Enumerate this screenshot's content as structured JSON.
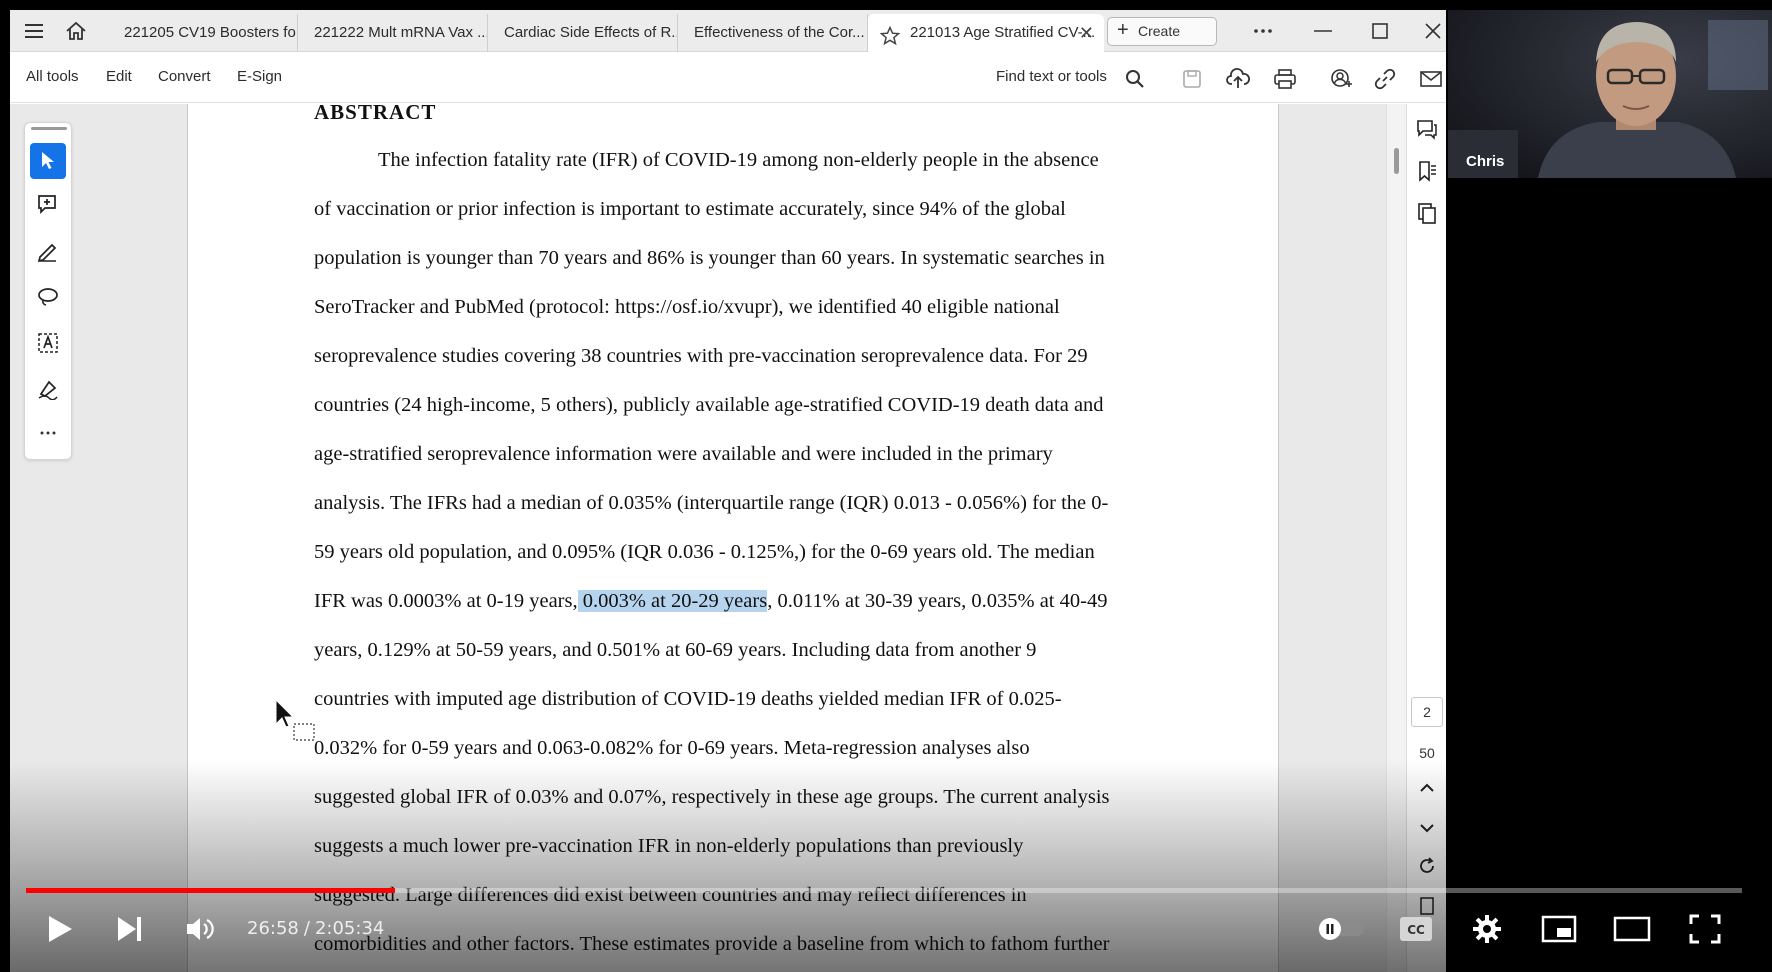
{
  "tabs": [
    {
      "label": "221205 CV19 Boosters fo..."
    },
    {
      "label": "221222 Mult mRNA Vax ..."
    },
    {
      "label": "Cardiac Side Effects of R..."
    },
    {
      "label": "Effectiveness of the Cor..."
    },
    {
      "label": "221013 Age Stratified CV-..."
    }
  ],
  "create_label": "Create",
  "menu": {
    "all_tools": "All tools",
    "edit": "Edit",
    "convert": "Convert",
    "esign": "E-Sign",
    "find": "Find text or tools"
  },
  "document": {
    "heading": "ABSTRACT",
    "lines": [
      "The infection fatality rate (IFR) of COVID-19 among non-elderly people in the absence",
      "of vaccination or prior infection is important to estimate accurately, since 94% of the global",
      "population is younger than 70 years and 86% is younger than 60 years. In systematic searches in",
      "SeroTracker and PubMed (protocol: https://osf.io/xvupr), we identified 40 eligible national",
      "seroprevalence studies covering 38 countries with pre-vaccination seroprevalence data. For 29",
      "countries (24 high-income, 5 others), publicly available age-stratified COVID-19 death data and",
      "age-stratified seroprevalence information were available and were included in the primary",
      "analysis. The IFRs had a median of 0.035% (interquartile range (IQR) 0.013 - 0.056%) for the 0-",
      "59 years old population, and 0.095% (IQR 0.036 - 0.125%,) for the 0-69 years old. The median"
    ],
    "line10": {
      "before": "IFR was 0.0003% at 0-19 years,",
      "highlight": " 0.003% at 20-29 years",
      "after": ", 0.011% at 30-39 years, 0.035% at 40-49"
    },
    "lines_after": [
      "years, 0.129% at 50-59 years, and 0.501% at 60-69 years. Including data from another 9",
      "countries with imputed age distribution of COVID-19 deaths yielded median IFR of 0.025-",
      "0.032% for 0-59 years and 0.063-0.082% for 0-69 years. Meta-regression analyses also",
      "suggested global IFR of 0.03% and 0.07%, respectively in these age groups. The current analysis",
      "suggests a much lower pre-vaccination IFR in non-elderly populations than previously",
      "suggested. Large differences did exist between countries and may reflect differences in",
      "comorbidities and other factors. These estimates provide a baseline from which to fathom further"
    ]
  },
  "page_nav": {
    "current": "2",
    "total": "50"
  },
  "webcam": {
    "name": "Chris"
  },
  "player": {
    "current_time": "26:58",
    "separator": "/",
    "duration": "2:05:34",
    "played_fraction": 0.215,
    "loaded_fraction": 0.205
  },
  "colors": {
    "accent": "#1473e6",
    "highlight": "#b7d4ef",
    "progress": "#ff0000"
  },
  "icons": [
    "menu-icon",
    "home-icon",
    "star-icon",
    "close-icon",
    "plus-icon",
    "more-icon",
    "minimize-icon",
    "maximize-icon",
    "search-icon",
    "save-icon",
    "upload-icon",
    "print-icon",
    "share-icon",
    "link-icon",
    "mail-icon",
    "select-cursor-icon",
    "comment-add-icon",
    "pen-icon",
    "lasso-icon",
    "text-box-icon",
    "sign-icon",
    "comments-icon",
    "bookmark-icon",
    "pages-icon",
    "chevron-up-icon",
    "chevron-down-icon",
    "refresh-icon",
    "play-icon",
    "next-icon",
    "volume-icon",
    "autoplay-toggle",
    "cc-icon",
    "settings-gear-icon",
    "miniplayer-icon",
    "theater-icon",
    "fullscreen-icon"
  ]
}
